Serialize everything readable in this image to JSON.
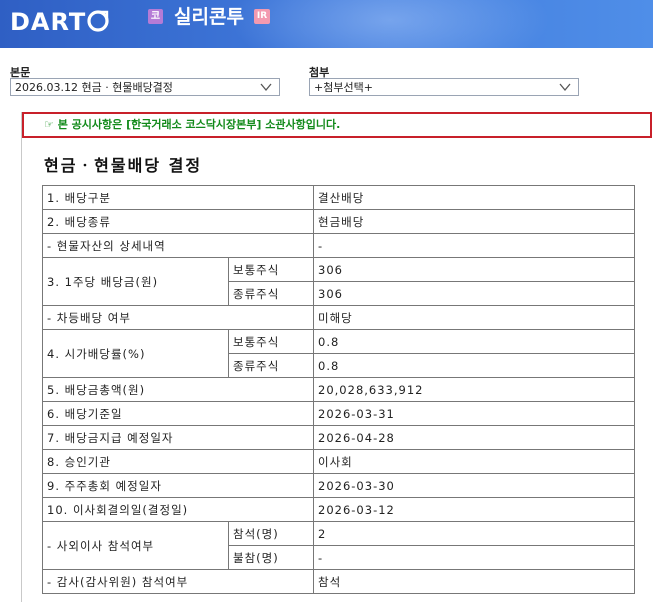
{
  "header": {
    "logo_text": "DART",
    "corp_badge": "코",
    "corp_name": "실리콘투",
    "ir_badge": "IR"
  },
  "selectors": {
    "body_label": "본문",
    "body_value": "2026.03.12  현금 · 현물배당결정",
    "attach_label": "첨부",
    "attach_value": "+첨부선택+"
  },
  "notice": {
    "icon": "☞",
    "text": "본 공시사항은 [한국거래소 코스닥시장본부] 소관사항입니다."
  },
  "document": {
    "title": "현금ㆍ현물배당 결정",
    "rows": {
      "r1_label": "1. 배당구분",
      "r1_value": "결산배당",
      "r2_label": "2. 배당종류",
      "r2_value": "현금배당",
      "r2a_label": "- 현물자산의 상세내역",
      "r2a_value": "-",
      "r3_label": "3. 1주당 배당금(원)",
      "r3_sub1": "보통주식",
      "r3_val1": "306",
      "r3_sub2": "종류주식",
      "r3_val2": "306",
      "r3a_label": "- 차등배당 여부",
      "r3a_value": "미해당",
      "r4_label": "4. 시가배당률(%)",
      "r4_sub1": "보통주식",
      "r4_val1": "0.8",
      "r4_sub2": "종류주식",
      "r4_val2": "0.8",
      "r5_label": "5. 배당금총액(원)",
      "r5_value": "20,028,633,912",
      "r6_label": "6. 배당기준일",
      "r6_value": "2026-03-31",
      "r7_label": "7. 배당금지급 예정일자",
      "r7_value": "2026-04-28",
      "r8_label": "8. 승인기관",
      "r8_value": "이사회",
      "r9_label": "9. 주주총회 예정일자",
      "r9_value": "2026-03-30",
      "r10_label": "10. 이사회결의일(결정일)",
      "r10_value": "2026-03-12",
      "r11_label": "- 사외이사 참석여부",
      "r11_sub1": "참석(명)",
      "r11_val1": "2",
      "r11_sub2": "불참(명)",
      "r11_val2": "-",
      "r12_label": "- 감사(감사위원) 참석여부",
      "r12_value": "참석"
    }
  },
  "colors": {
    "header_blue": "#3f78da",
    "notice_border": "#c8202a",
    "notice_text": "#128a1a"
  }
}
